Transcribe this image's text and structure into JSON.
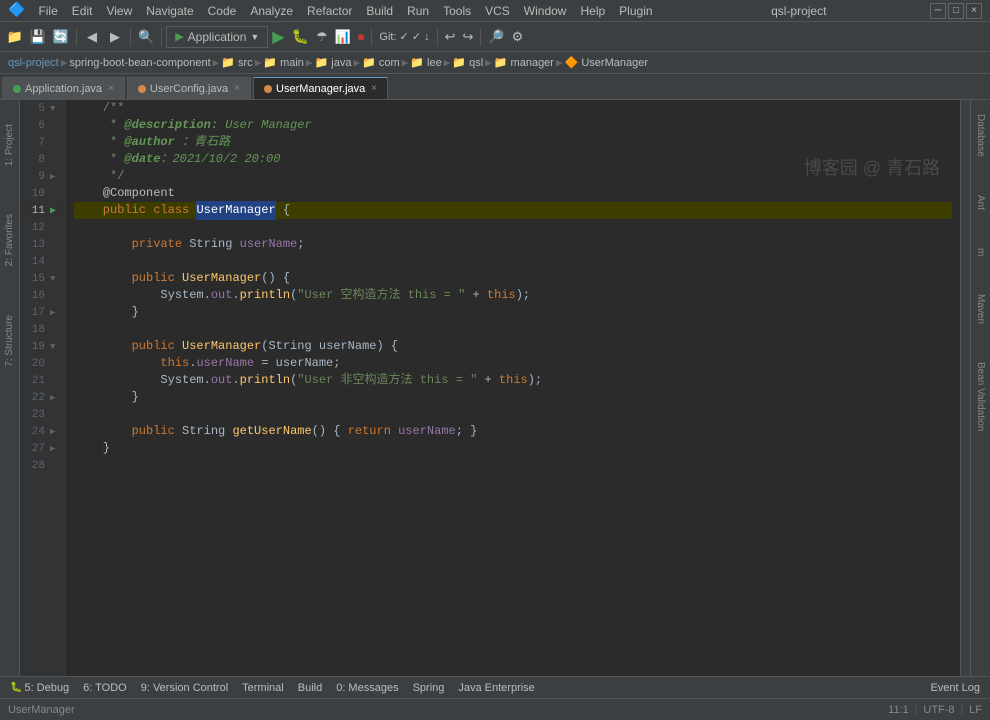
{
  "app": {
    "title": "qsl-project",
    "window_controls": [
      "minimize",
      "maximize",
      "close"
    ]
  },
  "menu": {
    "items": [
      "File",
      "Edit",
      "View",
      "Navigate",
      "Code",
      "Analyze",
      "Refactor",
      "Build",
      "Run",
      "Tools",
      "VCS",
      "Window",
      "Help",
      "Plugin"
    ]
  },
  "toolbar": {
    "run_config": "Application",
    "run_config_dropdown": "▼"
  },
  "breadcrumb": {
    "items": [
      "qsl-project",
      "spring-boot-bean-component",
      "src",
      "main",
      "java",
      "com",
      "lee",
      "qsl",
      "manager",
      "UserManager"
    ]
  },
  "tabs": [
    {
      "label": "Application.java",
      "active": false,
      "icon": "green"
    },
    {
      "label": "UserConfig.java",
      "active": false,
      "icon": "orange"
    },
    {
      "label": "UserManager.java",
      "active": true,
      "icon": "orange"
    }
  ],
  "code": {
    "lines": [
      {
        "num": 5,
        "indent": "    ",
        "content": "/**",
        "type": "comment"
      },
      {
        "num": 6,
        "indent": "     ",
        "content": "* @description: User Manager",
        "type": "javadoc"
      },
      {
        "num": 7,
        "indent": "     ",
        "content": "* @author ：青石路",
        "type": "javadoc"
      },
      {
        "num": 8,
        "indent": "     ",
        "content": "* @date：2021/10/2 20:00",
        "type": "javadoc"
      },
      {
        "num": 9,
        "indent": "     ",
        "content": "*/",
        "type": "comment"
      },
      {
        "num": 10,
        "indent": "    ",
        "content": "@Component",
        "type": "annotation"
      },
      {
        "num": 11,
        "indent": "    ",
        "content": "public class UserManager {",
        "type": "class-decl",
        "selected": true
      },
      {
        "num": 12,
        "indent": "",
        "content": "",
        "type": "blank"
      },
      {
        "num": 13,
        "indent": "        ",
        "content": "private String userName;",
        "type": "field"
      },
      {
        "num": 14,
        "indent": "",
        "content": "",
        "type": "blank"
      },
      {
        "num": 15,
        "indent": "        ",
        "content": "public UserManager() {",
        "type": "constructor"
      },
      {
        "num": 16,
        "indent": "            ",
        "content": "System.out.println(\"User 空构造方法 this = \" + this);",
        "type": "method-body"
      },
      {
        "num": 17,
        "indent": "        ",
        "content": "}",
        "type": "brace"
      },
      {
        "num": 18,
        "indent": "",
        "content": "",
        "type": "blank"
      },
      {
        "num": 19,
        "indent": "        ",
        "content": "public UserManager(String userName) {",
        "type": "constructor"
      },
      {
        "num": 20,
        "indent": "            ",
        "content": "this.userName = userName;",
        "type": "method-body"
      },
      {
        "num": 21,
        "indent": "            ",
        "content": "System.out.println(\"User 非空构造方法 this = \" + this);",
        "type": "method-body"
      },
      {
        "num": 22,
        "indent": "        ",
        "content": "}",
        "type": "brace"
      },
      {
        "num": 23,
        "indent": "",
        "content": "",
        "type": "blank"
      },
      {
        "num": 24,
        "indent": "        ",
        "content": "public String getUserName() { return userName; }",
        "type": "method"
      },
      {
        "num": 27,
        "indent": "    ",
        "content": "}",
        "type": "brace"
      },
      {
        "num": 28,
        "indent": "",
        "content": "",
        "type": "blank"
      }
    ],
    "watermark": "博客园 @ 青石路"
  },
  "right_panels": {
    "labels": [
      "Database",
      "Ant",
      "m",
      "Maven",
      "Bean Validation"
    ]
  },
  "left_panels": {
    "labels": [
      "1: Project",
      "2: Favorites",
      "7: Structure"
    ]
  },
  "bottom_tabs": {
    "items": [
      "5: Debug",
      "6: TODO",
      "9: Version Control",
      "Terminal",
      "Build",
      "0: Messages",
      "Spring",
      "Java Enterprise",
      "Event Log"
    ]
  },
  "status_bar": {
    "file": "UserManager",
    "encoding": "UTF-8",
    "line_col": "11:1"
  }
}
